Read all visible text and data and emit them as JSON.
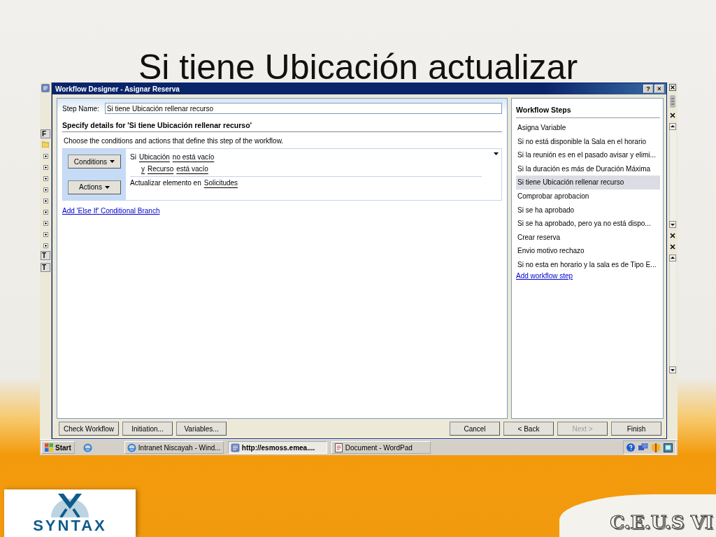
{
  "slide": {
    "title": "Si tiene Ubicación actualizar"
  },
  "background_window": {
    "tabs": [
      "F",
      "T",
      "T"
    ]
  },
  "window": {
    "title": "Workflow Designer - Asignar Reserva",
    "title_buttons": [
      "?",
      "×"
    ]
  },
  "step_name": {
    "label": "Step Name:",
    "value": "Si tiene Ubicación rellenar recurso"
  },
  "details": {
    "heading": "Specify details for 'Si tiene Ubicación rellenar recurso'",
    "description": "Choose the conditions and actions that define this step of the workflow.",
    "buttons": [
      "Conditions",
      "Actions"
    ],
    "conditions": [
      {
        "parts": [
          {
            "text": "Si",
            "link": false
          },
          {
            "text": "Ubicación",
            "link": true
          },
          {
            "text": "no está vacío",
            "link": true
          }
        ]
      },
      {
        "parts": [
          {
            "text": "y",
            "link": true
          },
          {
            "text": "Recurso",
            "link": true
          },
          {
            "text": "está vacío",
            "link": true
          }
        ]
      }
    ],
    "actions": [
      {
        "parts": [
          {
            "text": "Actualizar elemento en",
            "link": false
          },
          {
            "text": "Solicitudes",
            "link": true
          }
        ]
      }
    ],
    "else_link": "Add 'Else If' Conditional Branch"
  },
  "workflow_steps": {
    "title": "Workflow Steps",
    "items": [
      {
        "label": "Asigna Variable",
        "selected": false
      },
      {
        "label": "Si no está disponible la Sala en el horario",
        "selected": false
      },
      {
        "label": "Si la reunión es en el pasado avisar y elimi...",
        "selected": false
      },
      {
        "label": "Si la duración es más de Duración Máxima",
        "selected": false
      },
      {
        "label": "Si tiene Ubicación rellenar recurso",
        "selected": true
      },
      {
        "label": "Comprobar aprobacion",
        "selected": false
      },
      {
        "label": "Si se ha aprobado",
        "selected": false
      },
      {
        "label": "Si se ha aprobado, pero ya no está dispo...",
        "selected": false
      },
      {
        "label": "Crear reserva",
        "selected": false
      },
      {
        "label": "Envio motivo rechazo",
        "selected": false
      },
      {
        "label": "Si no esta en horario y la sala es de Tipo E...",
        "selected": false
      }
    ],
    "add_link": "Add workflow step"
  },
  "footer_buttons": {
    "left": [
      {
        "label": "Check Workflow",
        "disabled": false
      },
      {
        "label": "Initiation...",
        "disabled": false
      },
      {
        "label": "Variables...",
        "disabled": false
      }
    ],
    "right": [
      {
        "label": "Cancel",
        "disabled": false
      },
      {
        "label": "< Back",
        "disabled": false
      },
      {
        "label": "Next >",
        "disabled": true
      },
      {
        "label": "Finish",
        "disabled": false
      }
    ]
  },
  "taskbar": {
    "start": "Start",
    "tasks": [
      {
        "label": "Intranet Niscayah - Wind...",
        "selected": false
      },
      {
        "label": "http://esmoss.emea....",
        "selected": true
      },
      {
        "label": "Document - WordPad",
        "selected": false
      }
    ]
  },
  "logos": {
    "left": "SYNTAX",
    "right": "C.E.U.S VI"
  }
}
